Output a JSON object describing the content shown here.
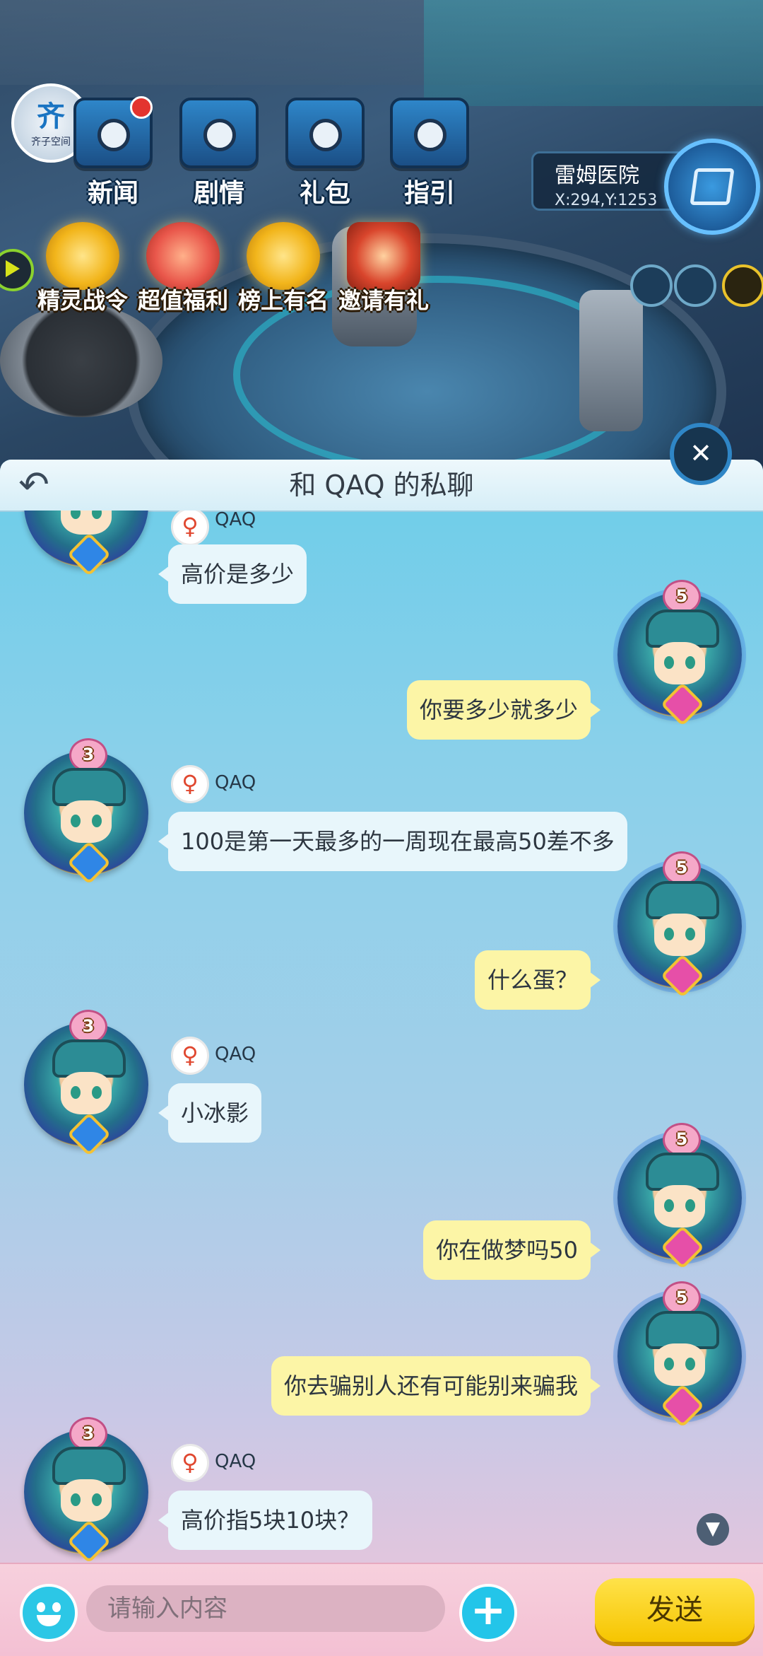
{
  "scene": {
    "top_buttons": [
      {
        "label": "新闻",
        "icon": "newspaper-icon"
      },
      {
        "label": "剧情",
        "icon": "story-icon"
      },
      {
        "label": "礼包",
        "icon": "giftpack-icon"
      },
      {
        "label": "指引",
        "icon": "guide-icon"
      }
    ],
    "features": [
      {
        "label": "精灵战令",
        "icon": "battle-pass-icon"
      },
      {
        "label": "超值福利",
        "icon": "gift-box-icon"
      },
      {
        "label": "榜上有名",
        "icon": "trophy-icon"
      },
      {
        "label": "邀请有礼",
        "icon": "invite-envelope-icon"
      }
    ],
    "logo": {
      "big": "齐",
      "small": "齐子空间"
    },
    "location": {
      "name": "雷姆医院",
      "coord": "X:294,Y:1253"
    }
  },
  "chat": {
    "title": "和 QAQ 的私聊",
    "other_gender_symbol": "♀",
    "messages": [
      {
        "from": "them",
        "name": "QAQ",
        "text": "高价是多少"
      },
      {
        "from": "me",
        "text": "你要多少就多少",
        "rank": "5"
      },
      {
        "from": "them",
        "name": "QAQ",
        "text": "100是第一天最多的一周现在最高50差不多",
        "rank": "3"
      },
      {
        "from": "me",
        "text": "什么蛋？",
        "rank": "5"
      },
      {
        "from": "them",
        "name": "QAQ",
        "text": "小冰影",
        "rank": "3"
      },
      {
        "from": "me",
        "text": "你在做梦吗50",
        "rank": "5"
      },
      {
        "from": "me",
        "text": "你去骗别人还有可能别来骗我",
        "rank": "5"
      },
      {
        "from": "them",
        "name": "QAQ",
        "text": "高价指5块10块？",
        "rank": "3"
      }
    ]
  },
  "input": {
    "placeholder": "请输入内容",
    "value": "",
    "send_label": "发送"
  },
  "colors": {
    "their_bubble": "#e8f6fb",
    "my_bubble": "#fcf5a6",
    "send_button": "#f6c500"
  }
}
